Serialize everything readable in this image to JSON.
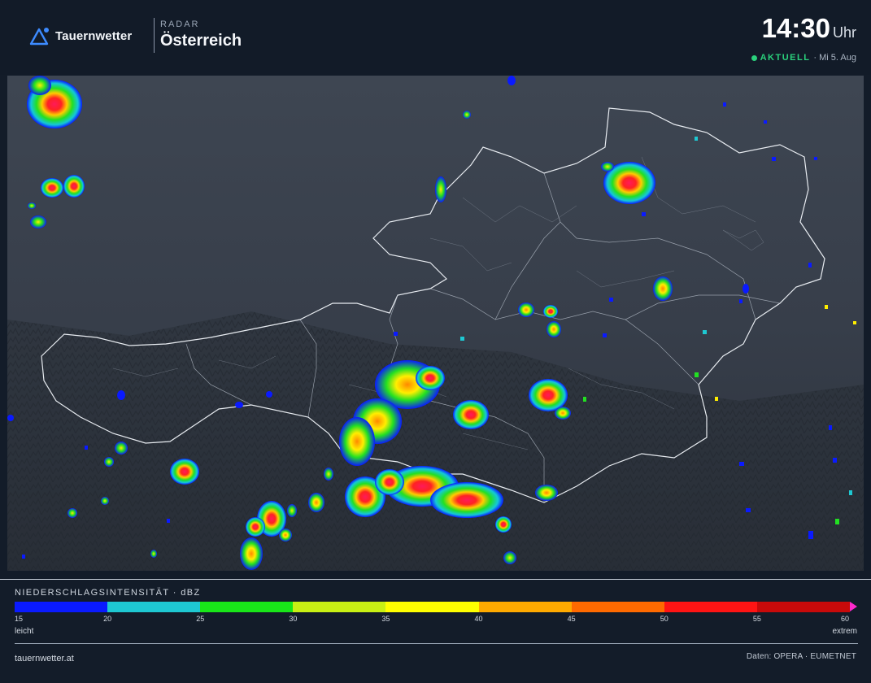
{
  "header": {
    "brand": "Tauernwetter",
    "kicker": "RADAR",
    "region": "Österreich",
    "time": "14:30",
    "time_unit": "Uhr",
    "status_live": "AKTUELL",
    "status_date": "· Mi 5. Aug"
  },
  "legend": {
    "title": "NIEDERSCHLAGSINTENSITÄT · dBZ",
    "segments": [
      "#0a1aff",
      "#1ec8d2",
      "#19e619",
      "#c8f014",
      "#ffff00",
      "#ffaa00",
      "#ff6a00",
      "#ff1414",
      "#c80a0a"
    ],
    "end_color": "#ff29cc",
    "ticks": [
      "15",
      "20",
      "25",
      "30",
      "35",
      "40",
      "45",
      "50",
      "55",
      "60"
    ],
    "low_label": "leicht",
    "high_label": "extrem"
  },
  "footer": {
    "site": "tauernwetter.at",
    "credits": "Daten: OPERA · EUMETNET"
  }
}
